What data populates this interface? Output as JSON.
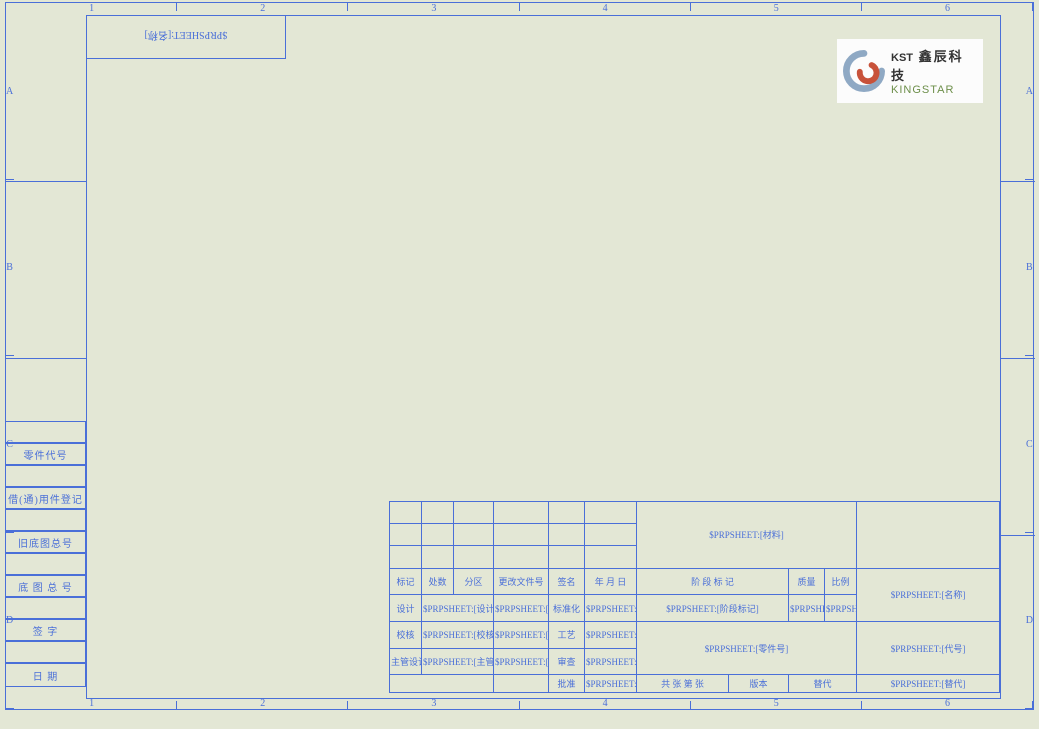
{
  "ruler": {
    "cols": [
      "1",
      "2",
      "3",
      "4",
      "5",
      "6"
    ],
    "rows": [
      "A",
      "B",
      "C",
      "D"
    ]
  },
  "tlbox_text": "$PRPSHEET:[名称]",
  "left_labels": {
    "l1": "零件代号",
    "l2": "借(通)用件登记",
    "l3": "旧底图总号",
    "l4": "底 图 总 号",
    "l5": "签    字",
    "l6": "日    期"
  },
  "title_block": {
    "material_field": "$PRPSHEET:[材料]",
    "headers": {
      "mark": "标记",
      "qty": "处数",
      "zone": "分区",
      "docno": "更改文件号",
      "sign": "签名",
      "date": "年 月 日"
    },
    "stage_header": "阶 段 标 记",
    "mass_header": "质量",
    "scale_header": "比例",
    "name_field": "$PRPSHEET:[名称]",
    "rows": {
      "design": "设计",
      "design_v": "$PRPSHEET:[设计]",
      "design_d": "$PRPSHEET:[设计日期]",
      "std": "标准化",
      "std_v": "$PRPSHEET:[标准化]",
      "std_d": "$PRPSHEET:[标准化日期]",
      "stage_v": "$PRPSHEET:[阶段标记]",
      "mass_v": "$PRPSHEET:[质量]",
      "scale_v": "$PRPSHEET:[比例]",
      "check": "校核",
      "check_v": "$PRPSHEET:[校核]",
      "check_d": "$PRPSHEET:[校核日期]",
      "proc": "工艺",
      "proc_v": "$PRPSHEET:[工艺]",
      "proc_d": "$PRPSHEET:[工艺日期]",
      "partno_v": "$PRPSHEET:[零件号]",
      "code_v": "$PRPSHEET:[代号]",
      "chief": "主管设计",
      "chief_v": "$PRPSHEET:[主管设计]",
      "chief_d": "$PRPSHEET:[主管设计日期]",
      "review": "审查",
      "review_v": "$PRPSHEET:[审查]",
      "review_d": "$PRPSHEET:[审查日期]",
      "approve": "批准",
      "approve_v": "$PRPSHEET:[批准]",
      "approve_d": "$PRPSHEET:[批准日期]",
      "sheet": "共  张  第  张",
      "ver": "版本",
      "replace": "替代",
      "replace_v": "$PRPSHEET:[替代]"
    }
  },
  "logo": {
    "kst": "KST",
    "cn": "鑫辰科技",
    "en": "KINGSTAR"
  }
}
